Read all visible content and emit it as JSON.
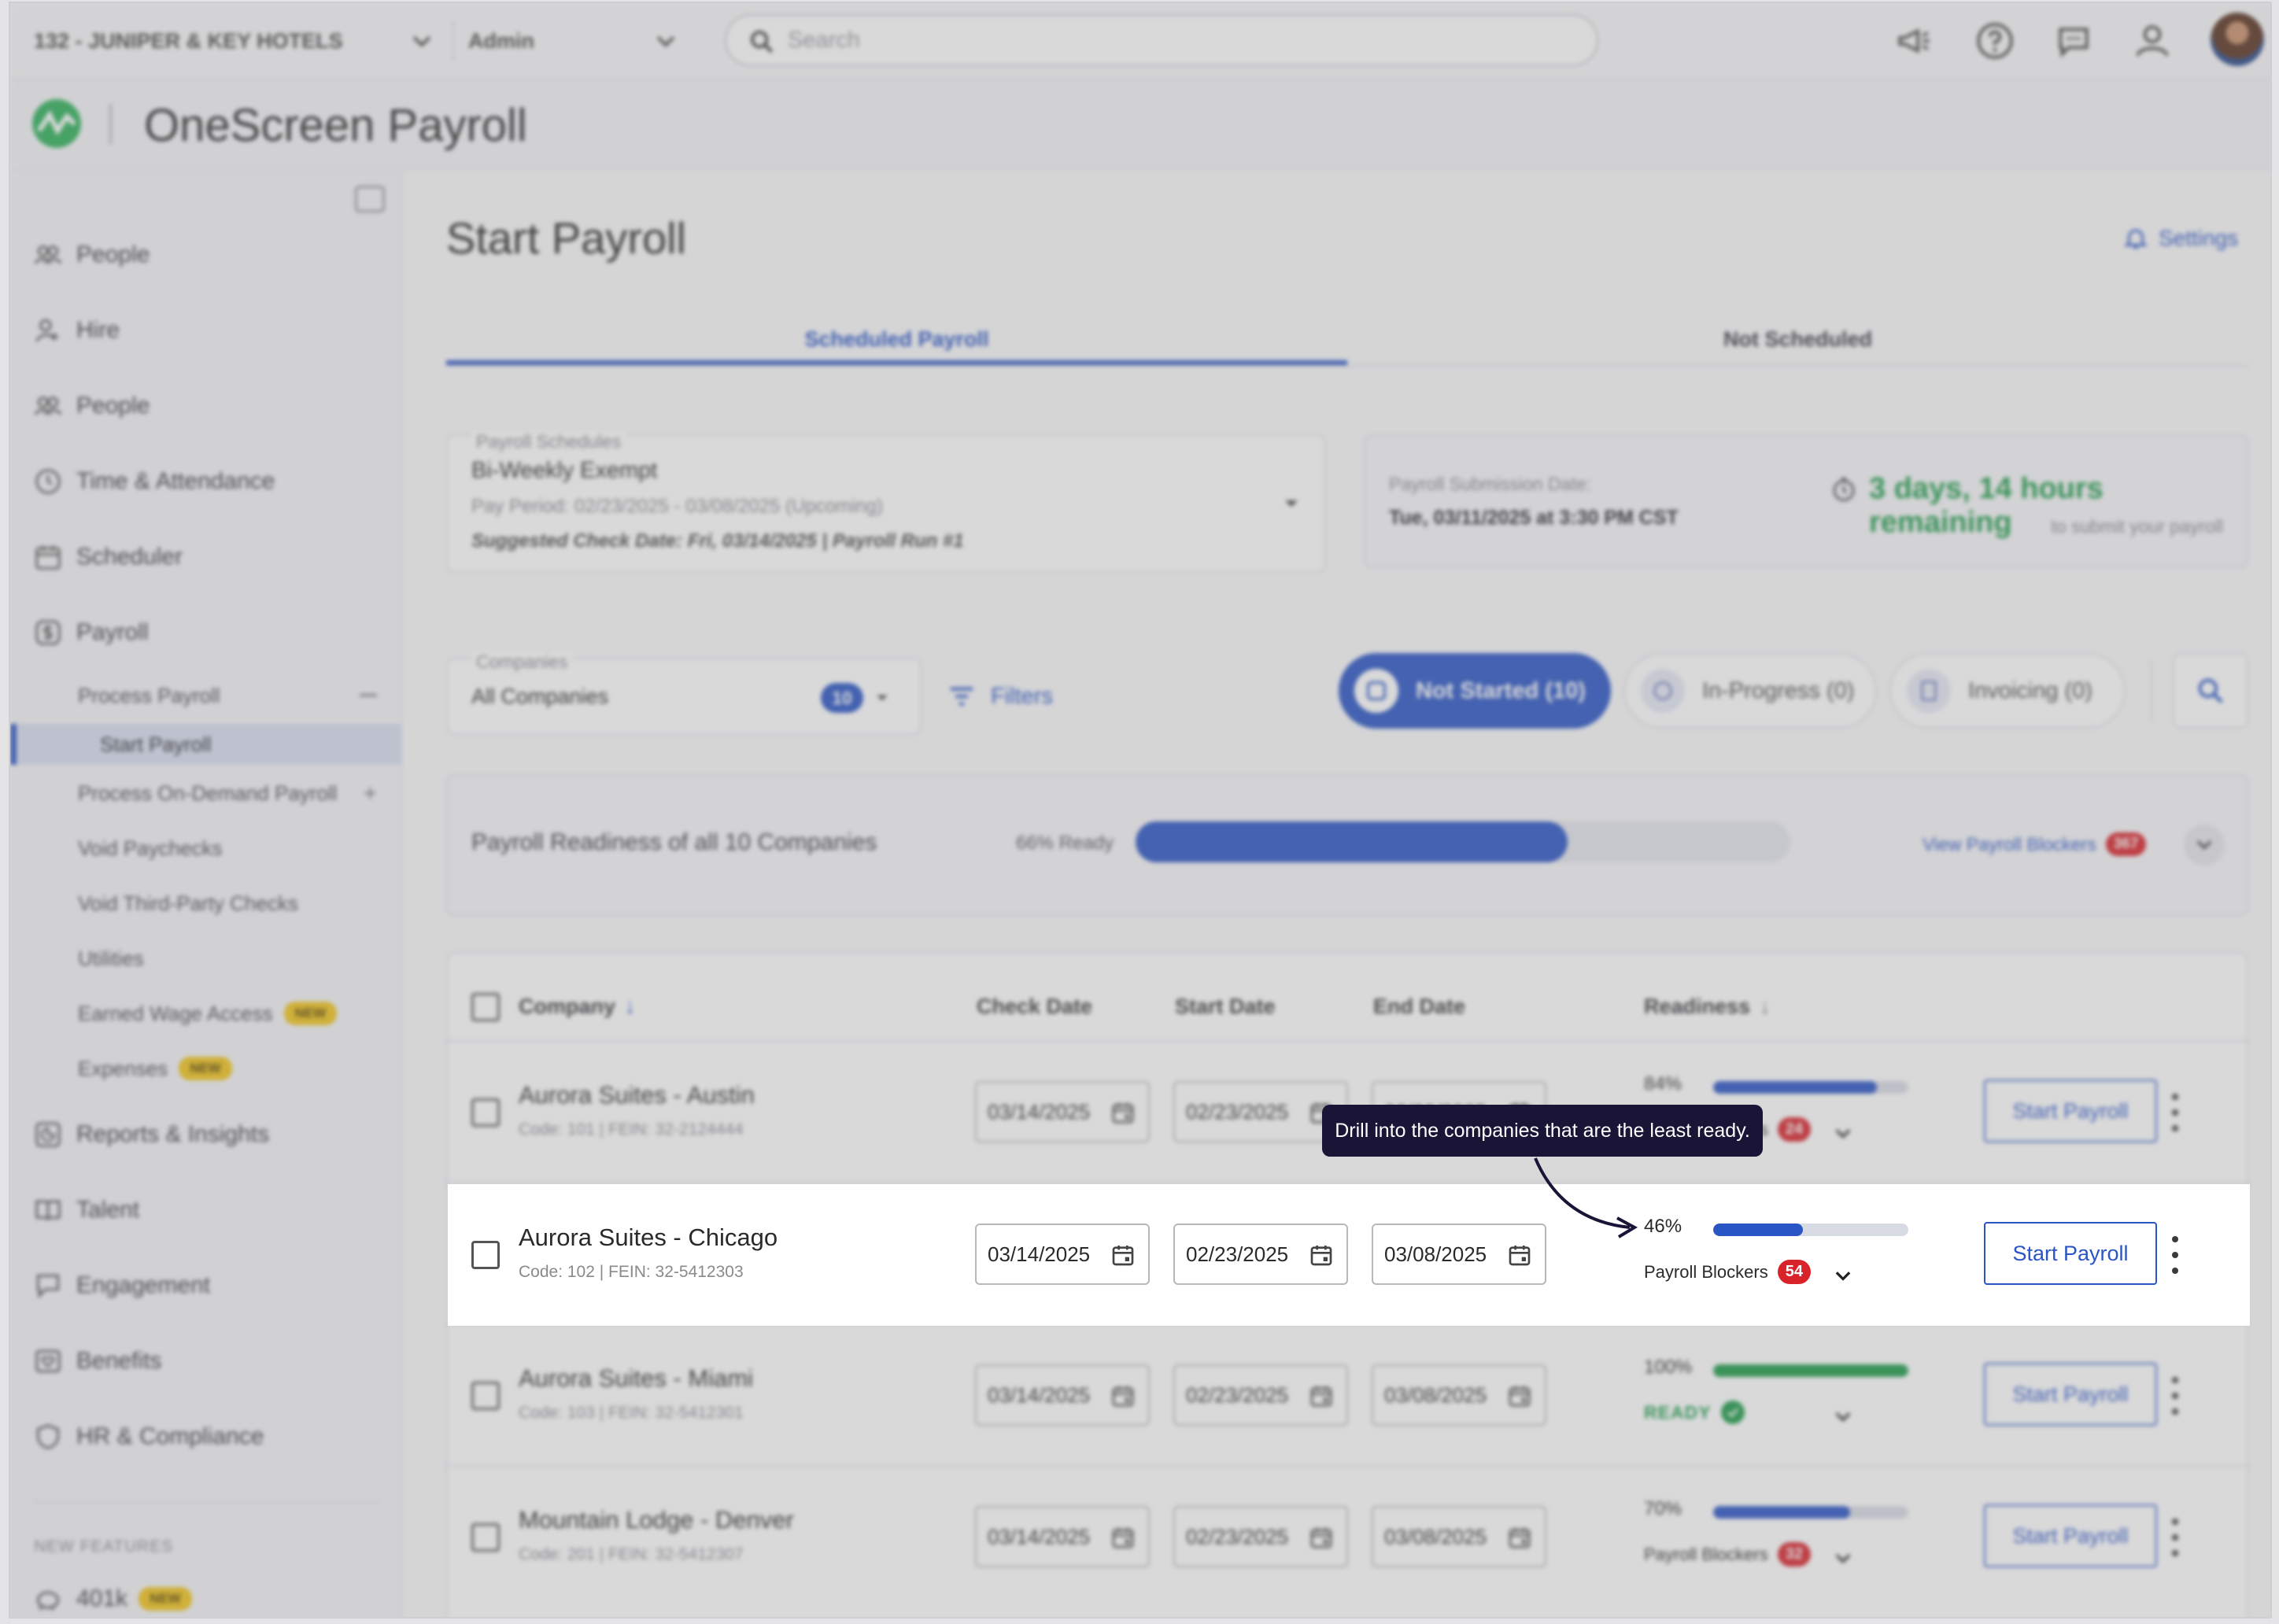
{
  "topbar": {
    "company_select": "132 - JUNIPER & KEY HOTELS",
    "role_select": "Admin",
    "search_placeholder": "Search",
    "icons": [
      "megaphone-icon",
      "help-icon",
      "chat-icon",
      "account-icon"
    ]
  },
  "brand": {
    "title": "OneScreen Payroll"
  },
  "sidebar": {
    "items": [
      {
        "label": "People",
        "icon": "people-icon"
      },
      {
        "label": "Hire",
        "icon": "hire-icon"
      },
      {
        "label": "People",
        "icon": "people-icon"
      },
      {
        "label": "Time & Attendance",
        "icon": "clock-icon"
      },
      {
        "label": "Scheduler",
        "icon": "calendar-icon"
      },
      {
        "label": "Payroll",
        "icon": "dollar-icon"
      }
    ],
    "payroll_sub": [
      {
        "label": "Process Payroll"
      },
      {
        "label": "Start Payroll"
      },
      {
        "label": "Process On-Demand Payroll"
      },
      {
        "label": "Void Paychecks"
      },
      {
        "label": "Void Third-Party Checks"
      },
      {
        "label": "Utilities"
      },
      {
        "label": "Earned Wage Access",
        "badge": "NEW"
      },
      {
        "label": "Expenses",
        "badge": "NEW"
      }
    ],
    "lower_items": [
      {
        "label": "Reports & Insights",
        "icon": "reports-icon"
      },
      {
        "label": "Talent",
        "icon": "book-icon"
      },
      {
        "label": "Engagement",
        "icon": "speech-icon"
      },
      {
        "label": "Benefits",
        "icon": "benefits-icon"
      },
      {
        "label": "HR & Compliance",
        "icon": "shield-icon"
      }
    ],
    "new_features_label": "NEW FEATURES",
    "new_feature_item": {
      "label": "401k",
      "badge": "NEW"
    }
  },
  "main": {
    "title": "Start Payroll",
    "settings_label": "Settings",
    "tabs": [
      {
        "label": "Scheduled Payroll"
      },
      {
        "label": "Not Scheduled"
      }
    ],
    "schedule": {
      "label": "Payroll Schedules",
      "value": "Bi-Weekly Exempt",
      "pay_period": "Pay Period: 02/23/2025 - 03/08/2025 (Upcoming)",
      "check_date": "Suggested Check Date: Fri, 03/14/2025 | Payroll Run #1"
    },
    "submission": {
      "label": "Payroll Submission Date:",
      "value": "Tue, 03/11/2025  at 3:30 PM CST",
      "remaining": "3 days, 14 hours remaining",
      "remaining_sub": "to submit your payroll",
      "remaining_color": "#1e9b48"
    },
    "companies": {
      "label": "Companies",
      "value": "All Companies",
      "count": "10"
    },
    "filters_label": "Filters",
    "status_pills": [
      {
        "label": "Not Started (10)"
      },
      {
        "label": "In-Progress (0)"
      },
      {
        "label": "Invoicing (0)"
      }
    ],
    "readiness": {
      "label": "Payroll Readiness of all 10 Companies",
      "percent_text": "66% Ready",
      "fraction": 0.66,
      "blockers_link": "View Payroll Blockers",
      "blockers_count": "367"
    },
    "table": {
      "headers": {
        "company": "Company",
        "check": "Check Date",
        "start": "Start Date",
        "end": "End Date",
        "readiness": "Readiness"
      },
      "action_label": "Start Payroll",
      "blockers_label": "Payroll Blockers",
      "ready_label": "READY",
      "rows": [
        {
          "name": "Aurora Suites - Austin",
          "code": "Code: 101  |  FEIN: 32-2124444",
          "check": "03/14/2025",
          "start": "02/23/2025",
          "end": "03/08/2025",
          "pct": "84%",
          "fraction": 0.84,
          "status": "blockers",
          "blockers": "24"
        },
        {
          "name": "Aurora Suites - Chicago",
          "code": "Code: 102  |  FEIN: 32-5412303",
          "check": "03/14/2025",
          "start": "02/23/2025",
          "end": "03/08/2025",
          "pct": "46%",
          "fraction": 0.46,
          "status": "blockers",
          "blockers": "54"
        },
        {
          "name": "Aurora Suites - Miami",
          "code": "Code: 103  |  FEIN: 32-5412301",
          "check": "03/14/2025",
          "start": "02/23/2025",
          "end": "03/08/2025",
          "pct": "100%",
          "fraction": 1.0,
          "status": "ready",
          "blockers": ""
        },
        {
          "name": "Mountain Lodge - Denver",
          "code": "Code: 201  |  FEIN: 32-5412307",
          "check": "03/14/2025",
          "start": "02/23/2025",
          "end": "03/08/2025",
          "pct": "70%",
          "fraction": 0.7,
          "status": "blockers",
          "blockers": "32"
        }
      ]
    }
  },
  "tooltip": {
    "text": "Drill into the companies that are the least ready."
  },
  "colors": {
    "accent": "#2a55c4",
    "ready_green": "#1e9b48",
    "danger": "#d8232a",
    "tooltip_bg": "#1a1436"
  }
}
